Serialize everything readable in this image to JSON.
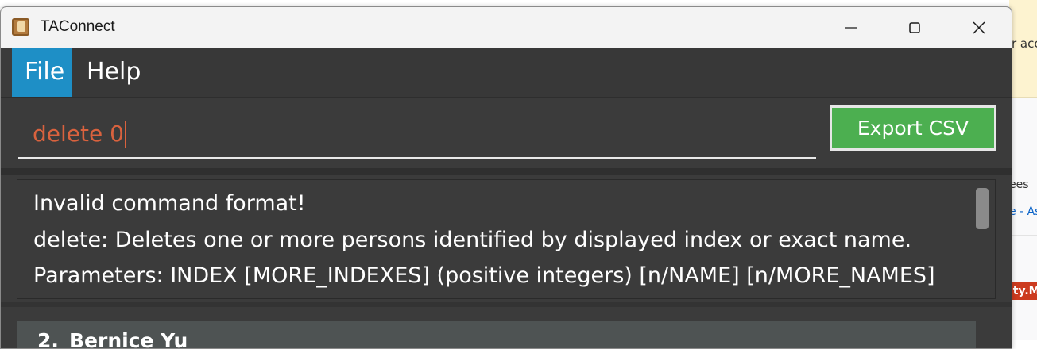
{
  "background": {
    "banner_text": "r acc",
    "text1": "ees",
    "text2": "e - As",
    "badge": "ity.M"
  },
  "window": {
    "title": "TAConnect",
    "controls": [
      "minimize",
      "maximize",
      "close"
    ]
  },
  "menu": {
    "items": [
      {
        "label": "File",
        "active": true
      },
      {
        "label": "Help",
        "active": false
      }
    ]
  },
  "command": {
    "value": "delete 0",
    "export_label": "Export CSV"
  },
  "result": {
    "lines": [
      "Invalid command format!",
      "delete: Deletes one or more persons identified by displayed index or exact name.",
      "Parameters: INDEX [MORE_INDEXES] (positive integers) [n/NAME] [n/MORE_NAMES]"
    ]
  },
  "person_list": [
    {
      "index": "2.",
      "name": "Bernice Yu"
    }
  ],
  "colors": {
    "accent_menu": "#1e8fc6",
    "export_button": "#4caf50",
    "command_text": "#d9623e",
    "panel_bg": "#3b3b3b"
  }
}
